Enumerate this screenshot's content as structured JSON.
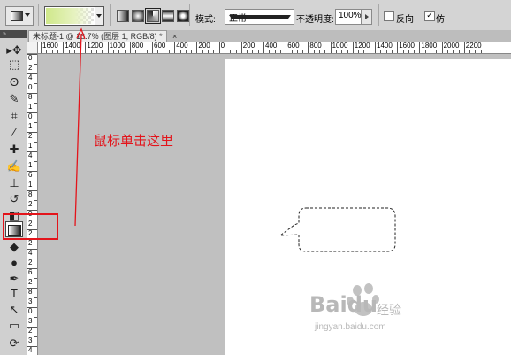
{
  "options_bar": {
    "tool_preset_icon": "gradient-tool-icon",
    "gradient_preview": {
      "start_color": "#cfe88a",
      "end": "transparent"
    },
    "gradient_types": [
      "linear",
      "radial",
      "angle",
      "reflected",
      "diamond"
    ],
    "active_gradient_type": "angle",
    "mode_label": "模式:",
    "mode_value": "正常",
    "opacity_label": "不透明度:",
    "opacity_value": "100%",
    "reverse_label": "反向",
    "reverse_checked": false,
    "dither_label": "仿",
    "dither_checked": true
  },
  "document_tab": {
    "title": "未标题-1 @ 16.7% (图层 1, RGB/8) *",
    "close_icon": "×"
  },
  "rulers": {
    "horizontal_labels": [
      "1600",
      "1400",
      "1200",
      "1000",
      "800",
      "600",
      "400",
      "200",
      "0",
      "200",
      "400",
      "600",
      "800",
      "1000",
      "1200",
      "1400",
      "1600",
      "1800",
      "2000",
      "2200"
    ],
    "vertical_digits": [
      "0",
      "2",
      "4",
      "0",
      "8",
      "1",
      "0",
      "1",
      "2",
      "1",
      "4",
      "1",
      "6",
      "1",
      "8",
      "2",
      "0",
      "2",
      "2",
      "2",
      "4",
      "2",
      "6",
      "2",
      "8",
      "3",
      "0",
      "3",
      "2",
      "3",
      "4"
    ]
  },
  "toolbox": {
    "grip_label": "»",
    "tools": [
      {
        "icon": "move-tool-icon",
        "glyph": "▸✥"
      },
      {
        "icon": "marquee-tool-icon",
        "glyph": "⬚"
      },
      {
        "icon": "lasso-tool-icon",
        "glyph": "ʘ"
      },
      {
        "icon": "quick-select-tool-icon",
        "glyph": "✎"
      },
      {
        "icon": "crop-tool-icon",
        "glyph": "⌗"
      },
      {
        "icon": "eyedropper-tool-icon",
        "glyph": "⁄"
      },
      {
        "icon": "healing-brush-tool-icon",
        "glyph": "✚"
      },
      {
        "icon": "brush-tool-icon",
        "glyph": "✍"
      },
      {
        "icon": "clone-stamp-tool-icon",
        "glyph": "⊥"
      },
      {
        "icon": "history-brush-tool-icon",
        "glyph": "↺"
      },
      {
        "icon": "eraser-tool-icon",
        "glyph": "◧"
      },
      {
        "icon": "gradient-tool-icon",
        "glyph": ""
      },
      {
        "icon": "blur-tool-icon",
        "glyph": "◆"
      },
      {
        "icon": "dodge-tool-icon",
        "glyph": "●"
      },
      {
        "icon": "pen-tool-icon",
        "glyph": "✒"
      },
      {
        "icon": "type-tool-icon",
        "glyph": "T"
      },
      {
        "icon": "path-select-tool-icon",
        "glyph": "↖"
      },
      {
        "icon": "shape-tool-icon",
        "glyph": "▭"
      },
      {
        "icon": "3d-rotate-tool-icon",
        "glyph": "⟳"
      }
    ],
    "active_tool": "gradient-tool-icon"
  },
  "annotation": {
    "text": "鼠标单击这里",
    "color": "#e3141b"
  },
  "watermark": {
    "logo": "Baidu",
    "cn": "经验",
    "url": "jingyan.baidu.com"
  }
}
